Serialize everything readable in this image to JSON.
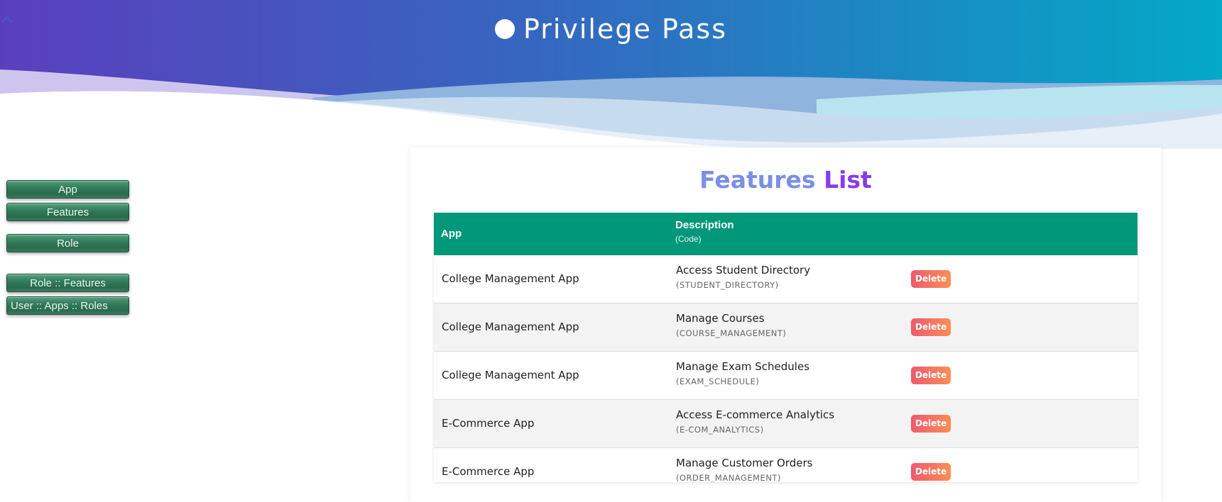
{
  "header": {
    "title": "Privilege Pass",
    "logo_icon": "wave-logo-icon"
  },
  "sidebar": {
    "items": [
      {
        "label": "App"
      },
      {
        "label": "Features"
      },
      {
        "label": "Role"
      },
      {
        "label": "Role :: Features"
      },
      {
        "label": "User :: Apps :: Roles"
      }
    ]
  },
  "main": {
    "title_part1": "Features",
    "title_part2": "List",
    "table": {
      "headers": {
        "app": "App",
        "description": "Description",
        "code": "(Code)"
      },
      "rows": [
        {
          "app": "College Management App",
          "description": "Access Student Directory",
          "code": "(STUDENT_DIRECTORY)",
          "action": "Delete"
        },
        {
          "app": "College Management App",
          "description": "Manage Courses",
          "code": "(COURSE_MANAGEMENT)",
          "action": "Delete"
        },
        {
          "app": "College Management App",
          "description": "Manage Exam Schedules",
          "code": "(EXAM_SCHEDULE)",
          "action": "Delete"
        },
        {
          "app": "E-Commerce App",
          "description": "Access E-commerce Analytics",
          "code": "(E-COM_ANALYTICS)",
          "action": "Delete"
        },
        {
          "app": "E-Commerce App",
          "description": "Manage Customer Orders",
          "code": "(ORDER_MANAGEMENT)",
          "action": "Delete"
        }
      ]
    }
  },
  "colors": {
    "header_gradient_start": "#5a3fbd",
    "header_gradient_end": "#03a9c6",
    "table_header": "#009879",
    "title_light": "#7b8fe6",
    "title_dark": "#8a3be8",
    "delete_start": "#ee5a6f",
    "delete_end": "#fb8e55",
    "sidebar_button": "#2f7656"
  }
}
